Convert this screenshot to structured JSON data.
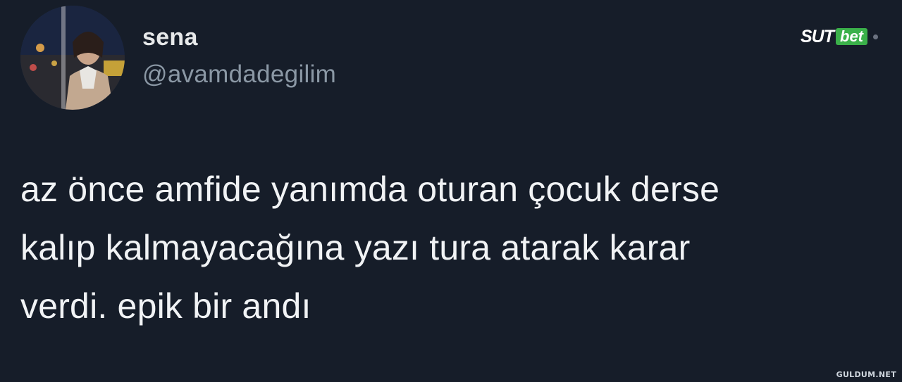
{
  "author": {
    "display_name": "sena",
    "handle": "@avamdadegilim",
    "avatar_icon": "profile-photo"
  },
  "tweet": {
    "lines": [
      "az önce amfide yanımda oturan çocuk derse",
      "kalıp kalmayacağına yazı tura atarak karar",
      "verdi. epik bir andı"
    ]
  },
  "brand": {
    "part1": "SUT",
    "part2": "bet",
    "accent_color": "#3bb14a"
  },
  "watermark": "GULDUM.NET",
  "colors": {
    "background": "#161d29",
    "text_primary": "#f1f3f5",
    "text_secondary": "#8b98a5"
  }
}
